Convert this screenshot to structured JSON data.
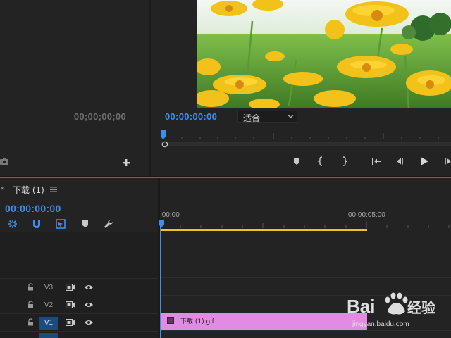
{
  "source_monitor": {
    "timecode": "00;00;00;00"
  },
  "program_monitor": {
    "timecode": "00:00:00:00",
    "zoom_select": "适合",
    "video_description": "yellow flowers field"
  },
  "timeline": {
    "sequence_tab": "下载 (1)",
    "timecode": "00:00:00:00",
    "ruler_labels": [
      ":00:00",
      "00:00:05:00"
    ],
    "tracks": [
      {
        "name": "V3",
        "active": false
      },
      {
        "name": "V2",
        "active": false
      },
      {
        "name": "V1",
        "active": true
      }
    ],
    "clip": {
      "name": "下载 (1).gif",
      "color": "#e28be2"
    }
  },
  "watermark": {
    "url": "jingyan.baidu.com"
  },
  "colors": {
    "accent_blue": "#3b8ff0",
    "work_area": "#e8c820",
    "panel_bg": "#232323"
  },
  "icons": [
    "camera-icon",
    "add-icon",
    "marker-icon",
    "in-point-icon",
    "out-point-icon",
    "go-to-in-icon",
    "step-back-icon",
    "play-icon",
    "step-forward-icon",
    "snap-icon",
    "magnet-icon",
    "linked-selection-icon",
    "wrench-icon",
    "lock-icon",
    "film-icon",
    "eye-icon",
    "menu-icon"
  ]
}
